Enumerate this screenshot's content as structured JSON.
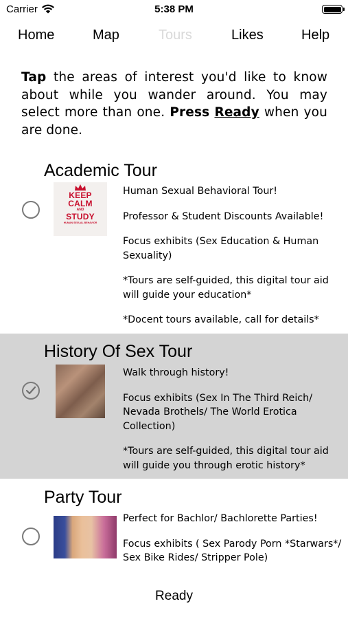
{
  "status_bar": {
    "carrier": "Carrier",
    "time": "5:38 PM"
  },
  "tabs": [
    {
      "label": "Home"
    },
    {
      "label": "Map"
    },
    {
      "label": "Tours",
      "active": true
    },
    {
      "label": "Likes"
    },
    {
      "label": "Help"
    }
  ],
  "intro": {
    "tap": "Tap",
    "text1": " the areas of interest you'd like to know about while you wander around. You may select more than one. ",
    "press": "Press",
    "ready": "Ready",
    "text2": " when you are done."
  },
  "tours": [
    {
      "title": "Academic Tour",
      "selected": false,
      "thumb_text": [
        "KEEP",
        "CALM",
        "AND",
        "STUDY",
        "HUMAN SEXUAL BEHAVIOR"
      ],
      "lines": [
        "Human Sexual Behavioral Tour!",
        "Professor & Student Discounts Available!",
        "Focus exhibits (Sex Education & Human Sexuality)",
        "*Tours are self-guided, this digital tour aid will guide your education*",
        "*Docent tours available, call for details*"
      ]
    },
    {
      "title": "History Of Sex Tour",
      "selected": true,
      "lines": [
        "Walk through history!",
        "Focus exhibits (Sex In The Third Reich/ Nevada Brothels/ The World Erotica Collection)",
        "*Tours are self-guided, this digital tour aid will guide you through erotic history*"
      ]
    },
    {
      "title": "Party Tour",
      "selected": false,
      "lines": [
        "Perfect for Bachlor/ Bachlorette Parties!",
        "Focus exhibits ( Sex Parody Porn *Starwars*/ Sex Bike Rides/ Stripper Pole)"
      ]
    }
  ],
  "ready_button": "Ready",
  "colors": {
    "selected_row": "#d4d4d4",
    "inactive_tab": "#d9d9d9",
    "keep_calm_red": "#c8102e"
  },
  "icons": {
    "wifi": "wifi-icon",
    "battery": "battery-icon",
    "radio_off": "radio-unchecked-icon",
    "radio_on": "radio-checked-icon"
  }
}
